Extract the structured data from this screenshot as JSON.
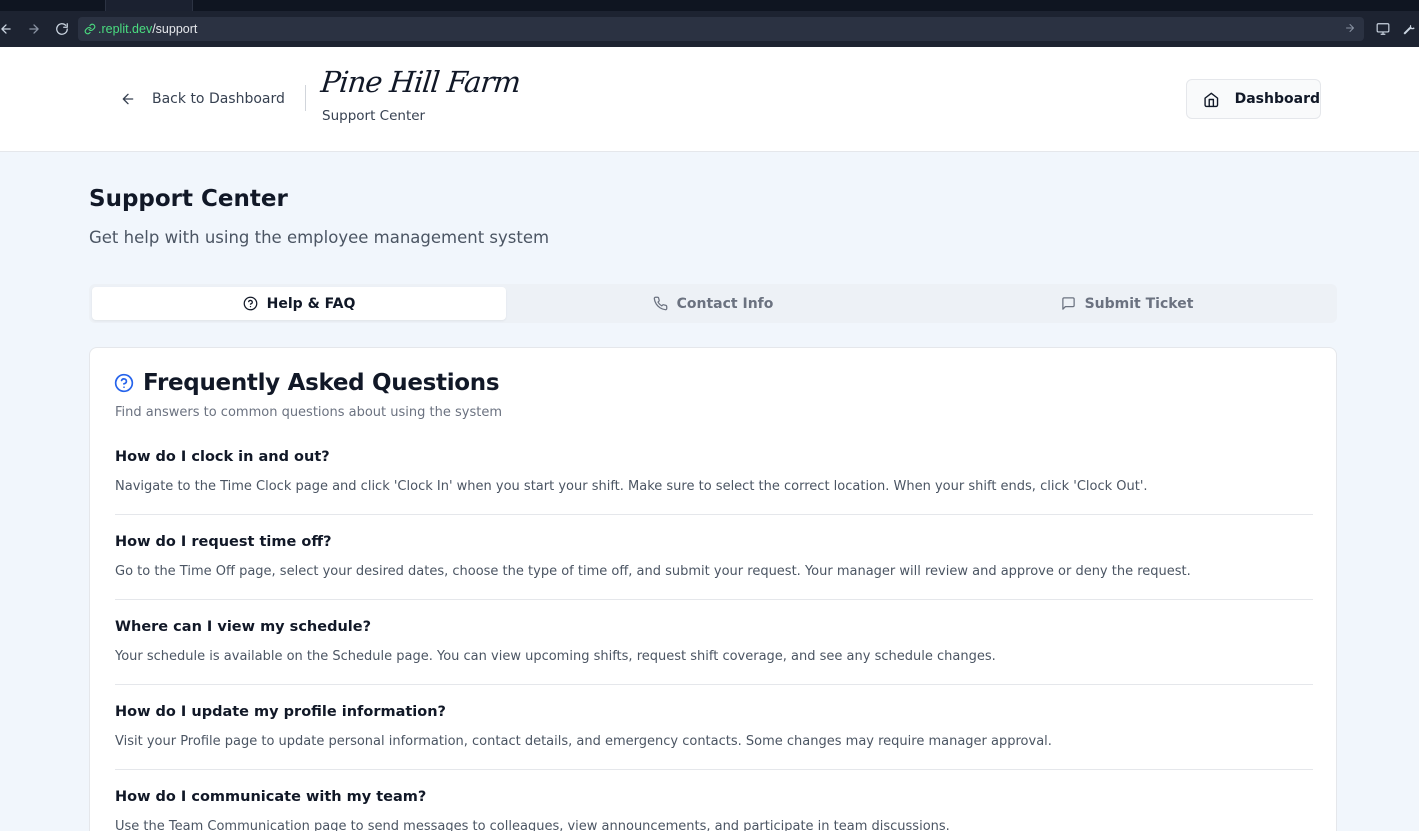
{
  "browser": {
    "url_host": ".replit.dev",
    "url_path": "/support"
  },
  "header": {
    "back_label": "Back to Dashboard",
    "logo_text": "Pine Hill Farm",
    "logo_subtitle": "Support Center",
    "dashboard_label": "Dashboard"
  },
  "page": {
    "title": "Support Center",
    "subtitle": "Get help with using the employee management system"
  },
  "tabs": [
    {
      "label": "Help & FAQ",
      "icon": "help-circle-icon",
      "active": true
    },
    {
      "label": "Contact Info",
      "icon": "phone-icon",
      "active": false
    },
    {
      "label": "Submit Ticket",
      "icon": "message-square-icon",
      "active": false
    }
  ],
  "faq": {
    "title": "Frequently Asked Questions",
    "description": "Find answers to common questions about using the system",
    "items": [
      {
        "q": "How do I clock in and out?",
        "a": "Navigate to the Time Clock page and click 'Clock In' when you start your shift. Make sure to select the correct location. When your shift ends, click 'Clock Out'."
      },
      {
        "q": "How do I request time off?",
        "a": "Go to the Time Off page, select your desired dates, choose the type of time off, and submit your request. Your manager will review and approve or deny the request."
      },
      {
        "q": "Where can I view my schedule?",
        "a": "Your schedule is available on the Schedule page. You can view upcoming shifts, request shift coverage, and see any schedule changes."
      },
      {
        "q": "How do I update my profile information?",
        "a": "Visit your Profile page to update personal information, contact details, and emergency contacts. Some changes may require manager approval."
      },
      {
        "q": "How do I communicate with my team?",
        "a": "Use the Team Communication page to send messages to colleagues, view announcements, and participate in team discussions."
      }
    ]
  },
  "colors": {
    "accent": "#2563eb",
    "page_bg": "#f1f6fc",
    "url_host": "#4ade80"
  }
}
